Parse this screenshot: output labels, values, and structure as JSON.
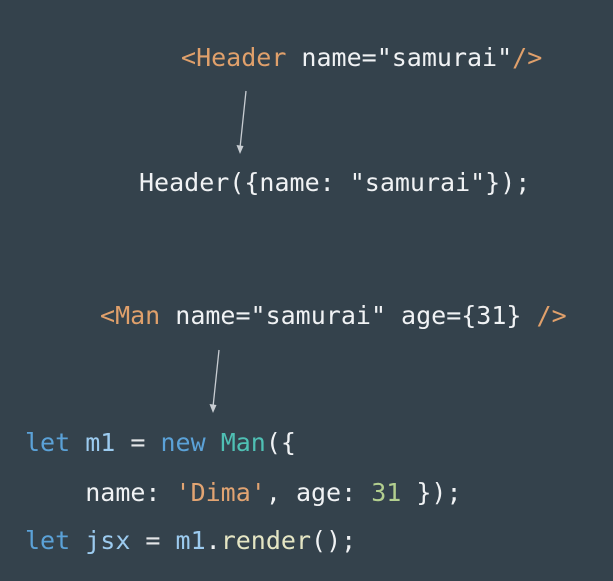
{
  "code_slide": {
    "line1": {
      "open": "<",
      "tag": "Header",
      "attr": " name=",
      "value": "\"samurai\"",
      "close": "/>"
    },
    "line2": {
      "text": "Header({name: \"samurai\"});"
    },
    "line3": {
      "open": "<",
      "tag": "Man",
      "attr1": " name=",
      "value1": "\"samurai\"",
      "attr2": " age={31} ",
      "close": "/>"
    },
    "line4": {
      "kw": "let",
      "sp1": " ",
      "var": "m1",
      "eq": " = ",
      "new": "new",
      "sp2": " ",
      "cls": "Man",
      "paren": "({"
    },
    "line5": {
      "indent": "    ",
      "key1": "name: ",
      "str": "'Dima'",
      "key2": ", age: ",
      "num": "31",
      "end": " });"
    },
    "line6": {
      "kw": "let",
      "sp1": " ",
      "var": "jsx",
      "eq": " = ",
      "obj": "m1",
      "dot": ".",
      "method": "render",
      "end": "();"
    },
    "colors": {
      "background": "#34424c",
      "tag": "#e0a06b",
      "keyword": "#5ba2d8",
      "class": "#4fc0b4",
      "string": "#e2a472",
      "number": "#b3cf8f",
      "function": "#e5e6c4",
      "arrow": "#c8cdd2"
    }
  }
}
